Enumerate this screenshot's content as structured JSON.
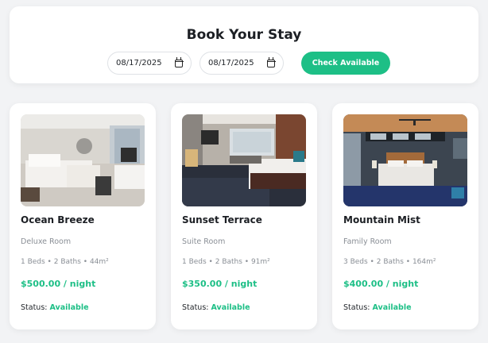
{
  "booking": {
    "title": "Book Your Stay",
    "check_in": "08/17/2025",
    "check_out": "08/17/2025",
    "button_label": "Check Available",
    "accent_color": "#1dbf86"
  },
  "rooms": [
    {
      "name": "Ocean Breeze",
      "type": "Deluxe Room",
      "specs": "1 Beds • 2 Baths • 44m²",
      "price": "$500.00 / night",
      "status_label": "Status:",
      "status_value": "Available"
    },
    {
      "name": "Sunset Terrace",
      "type": "Suite Room",
      "specs": "1 Beds • 2 Baths • 91m²",
      "price": "$350.00 / night",
      "status_label": "Status:",
      "status_value": "Available"
    },
    {
      "name": "Mountain Mist",
      "type": "Family Room",
      "specs": "3 Beds • 2 Baths • 164m²",
      "price": "$400.00 / night",
      "status_label": "Status:",
      "status_value": "Available"
    }
  ]
}
